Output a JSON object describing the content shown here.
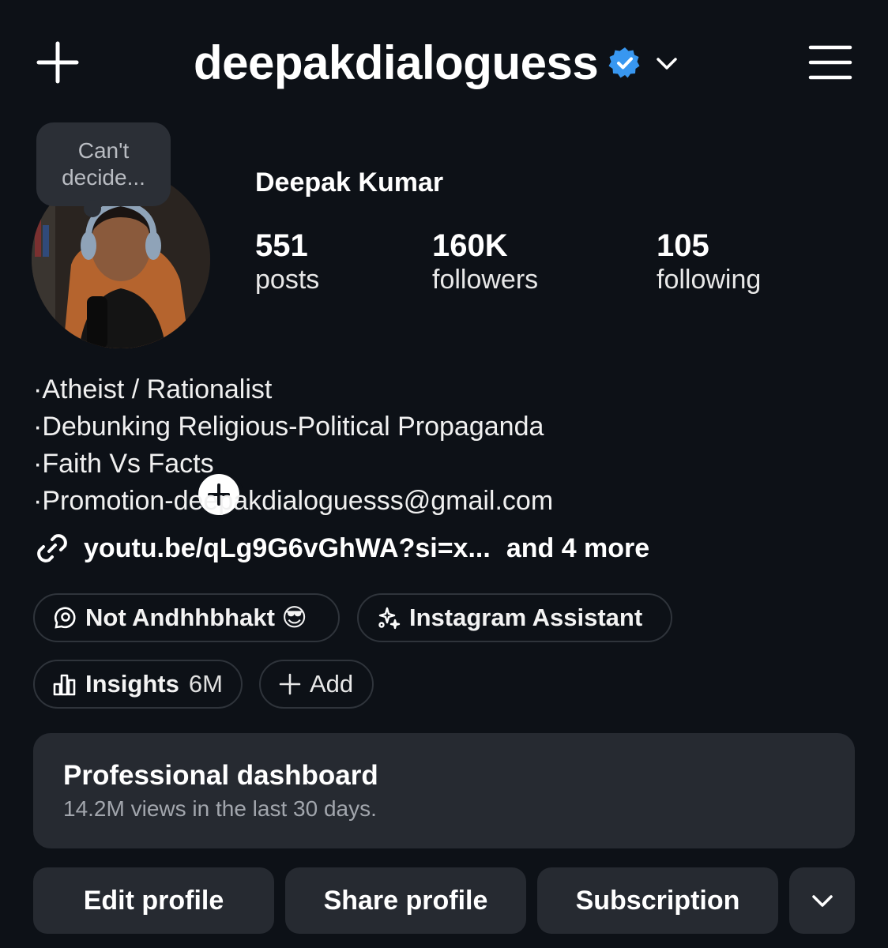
{
  "header": {
    "username": "deepakdialoguess",
    "icons": {
      "create": "plus-icon",
      "verified": "verified-badge-icon",
      "switch": "chevron-down-icon",
      "menu": "hamburger-menu-icon"
    },
    "accent_color": "#3897f0"
  },
  "profile": {
    "note": "Can't decide...",
    "name": "Deepak Kumar",
    "stats": [
      {
        "value": "551",
        "label": "posts"
      },
      {
        "value": "160K",
        "label": "followers"
      },
      {
        "value": "105",
        "label": "following"
      }
    ]
  },
  "bio": {
    "lines": [
      "·Atheist / Rationalist",
      "·Debunking Religious-Political Propaganda",
      "·Faith Vs Facts",
      "·Promotion-deepakdialoguesss@gmail.com"
    ],
    "link": "youtu.be/qLg9G6vGhWA?si=x...",
    "link_more": "and 4 more"
  },
  "chips": {
    "channel": {
      "label": "Not Andhhbhakt 😎",
      "icon": "threads-chat-icon"
    },
    "assistant": {
      "label": "Instagram Assistant",
      "icon": "sparkle-icon"
    },
    "insights": {
      "label": "Insights",
      "value": "6M",
      "icon": "bar-chart-icon"
    },
    "add": {
      "label": "Add",
      "icon": "plus-icon"
    }
  },
  "dashboard": {
    "title": "Professional dashboard",
    "subtitle": "14.2M views in the last 30 days."
  },
  "actions": {
    "edit": "Edit profile",
    "share": "Share profile",
    "subscription": "Subscription"
  }
}
